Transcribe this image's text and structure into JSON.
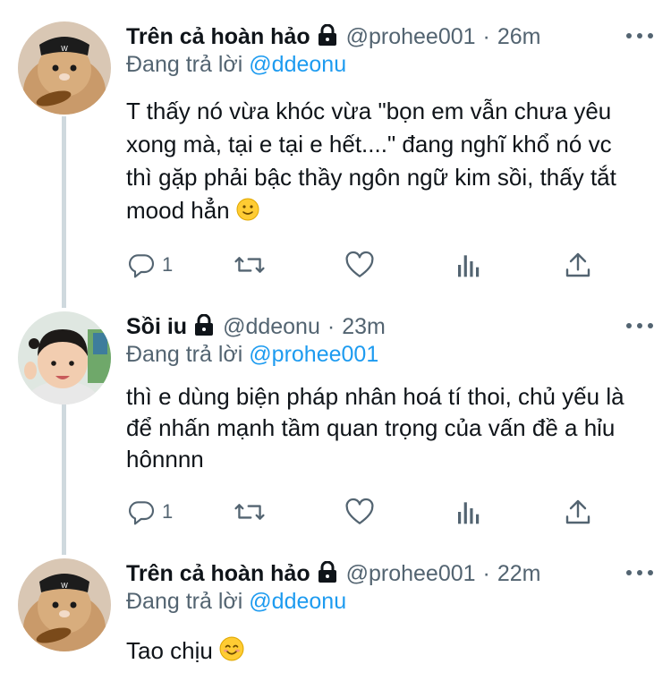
{
  "thread": [
    {
      "name": "Trên cả hoàn hảo",
      "handle": "@prohee001",
      "separator": "·",
      "time": "26m",
      "replying_prefix": "Đang trả lời",
      "replying_to": "@ddeonu",
      "text": "T thấy nó vừa khóc vừa \"bọn em vẫn chưa yêu xong mà, tại e tại e hết....\" đang nghĩ khổ nó vc thì gặp phải bậc thầy ngôn ngữ kim sồi, thấy tắt mood hẳn",
      "emoji": "slightly-smiling-face",
      "reply_count": "1"
    },
    {
      "name": "Sồi iu",
      "handle": "@ddeonu",
      "separator": "·",
      "time": "23m",
      "replying_prefix": "Đang trả lời",
      "replying_to": "@prohee001",
      "text": "thì e dùng biện pháp nhân hoá tí thoi, chủ yếu là để nhấn mạnh tầm quan trọng của vấn đề a hỉu hônnnn",
      "reply_count": "1"
    },
    {
      "name": "Trên cả hoàn hảo",
      "handle": "@prohee001",
      "separator": "·",
      "time": "22m",
      "replying_prefix": "Đang trả lời",
      "replying_to": "@ddeonu",
      "text": "Tao chịu",
      "emoji": "smiling-face-with-smiling-eyes"
    }
  ],
  "icons": {
    "lock": "lock-icon",
    "more": "more-icon",
    "reply": "reply-icon",
    "retweet": "retweet-icon",
    "like": "like-icon",
    "analytics": "analytics-icon",
    "share": "share-icon"
  },
  "colors": {
    "text": "#0f1419",
    "secondary": "#536471",
    "link": "#1d9bf0",
    "thread_line": "#cfd9de"
  }
}
